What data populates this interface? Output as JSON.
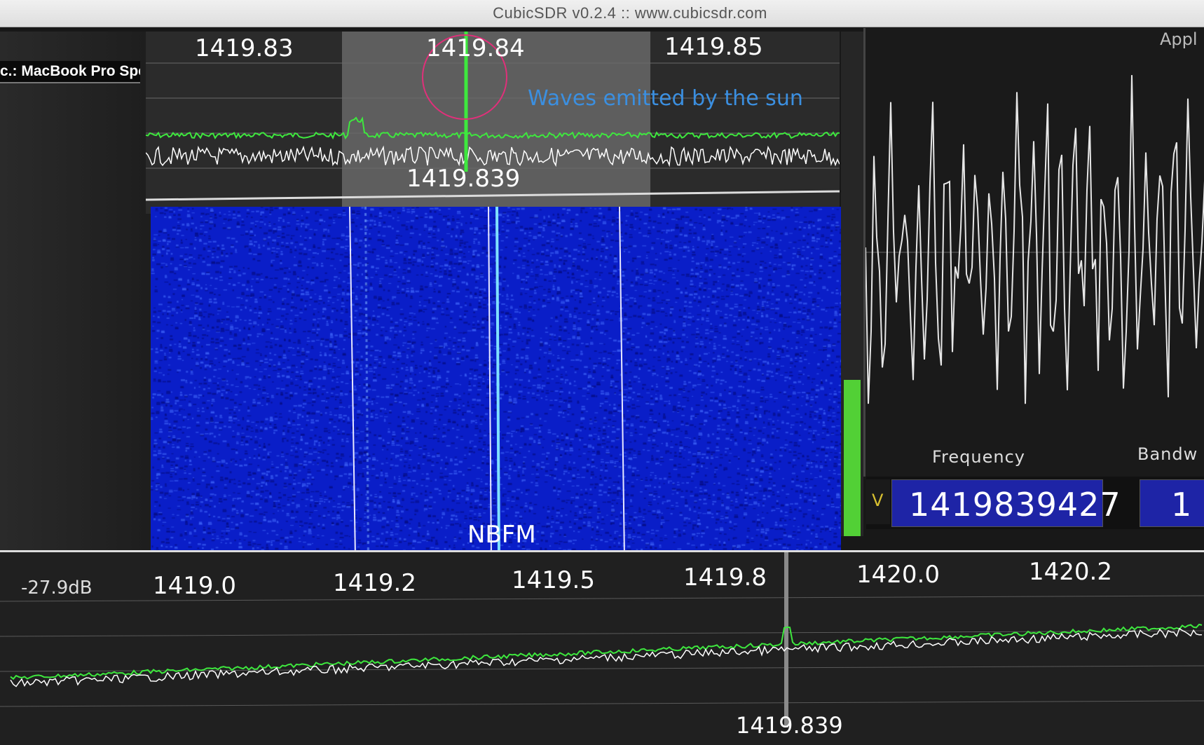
{
  "window": {
    "title": "CubicSDR v0.2.4 :: www.cubicsdr.com"
  },
  "device": {
    "label": "c.: MacBook Pro Spe"
  },
  "spectrum": {
    "ticks": [
      "1419.83",
      "1419.84",
      "1419.85"
    ],
    "center_label": "1419.839",
    "annotation": "Waves emitted by the sun",
    "annotation_color": "#3b8fe0",
    "circle_color": "#e0307a",
    "trace_colors": {
      "peak_hold": "#3ee83e",
      "live": "#ffffff"
    }
  },
  "waterfall": {
    "mode_label": "NBFM",
    "color": "#0a1ec8"
  },
  "level_meter": {
    "fill_fraction": 0.31,
    "color": "#52d036"
  },
  "scope": {
    "label_frequency": "Frequency",
    "label_bandwidth": "Bandw",
    "top_right_text": "Appl"
  },
  "frequency_control": {
    "v_label": "V",
    "frequency_value": "1419839427",
    "bandwidth_value": "1"
  },
  "bottom_spectrum": {
    "level_label": "-27.9dB",
    "ticks": [
      "1419.0",
      "1419.2",
      "1419.5",
      "1419.8",
      "1420.0",
      "1420.2"
    ],
    "center_label": "1419.839"
  }
}
